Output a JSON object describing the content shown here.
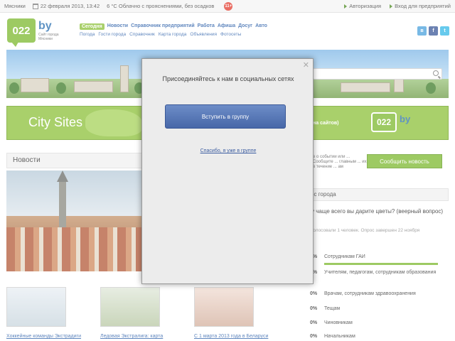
{
  "topbar": {
    "city": "Мясники",
    "date": "22 февраля 2013, 13:42",
    "weather": "6 °C Облачно с прояснениями, без осадков",
    "notif_count": "11+",
    "login": "Авторизация",
    "business": "Вход для предприятий"
  },
  "header": {
    "logo_text": "022",
    "logo_by": "by",
    "logo_sub": "Сайт города Мясники",
    "nav": [
      "Сегодня",
      "Новости",
      "Справочник предприятий",
      "Работа",
      "Афиша",
      "Досуг",
      "Авто"
    ],
    "subnav": [
      "Погода",
      "Гости города",
      "Справочник",
      "Карта города",
      "Объявления",
      "Фотосеты"
    ]
  },
  "citybar": {
    "label": "City Sites",
    "slogan": "на сайтов)",
    "logo_text": "022",
    "logo_by": "by"
  },
  "news": {
    "heading": "Новости",
    "thumbs": [
      {
        "caption": "Хоккейные команды Экстрадиги"
      },
      {
        "caption": "Ледовая Экстралига: карта"
      },
      {
        "caption": "С 1 марта 2013 года в Беларуси"
      }
    ]
  },
  "right": {
    "info_text": "е о событии или ... Сообщите ... главным ... их в течение ... ам",
    "report_button": "Сообщить новость",
    "poll_heading": "ос города",
    "poll_question": "у чаще всего вы дарите цветы? (веерный вопрос)",
    "poll_meta": "голосовали 1 человек. Опрос завершен 22 ноября",
    "poll_options": [
      {
        "pct": "0%",
        "label": "Сотрудникам ГАИ"
      },
      {
        "pct": "0%",
        "label": "Учителям, педагогам, сотрудникам образования"
      },
      {
        "pct": "0%",
        "label": "Врачам, сотрудникам здравоохранения"
      },
      {
        "pct": "0%",
        "label": "Тещам"
      },
      {
        "pct": "0%",
        "label": "Чиновникам"
      },
      {
        "pct": "0%",
        "label": "Начальникам"
      }
    ]
  },
  "modal": {
    "title": "Присоединяйтесь к нам в социальных сетях",
    "join_button": "Вступить в группу",
    "already_link": "Спасибо, я уже в группе",
    "close_icon": "close-icon"
  },
  "colors": {
    "brand_green": "#7cb82f",
    "fb_blue": "#4767a8",
    "link_blue": "#2a5ea8"
  }
}
